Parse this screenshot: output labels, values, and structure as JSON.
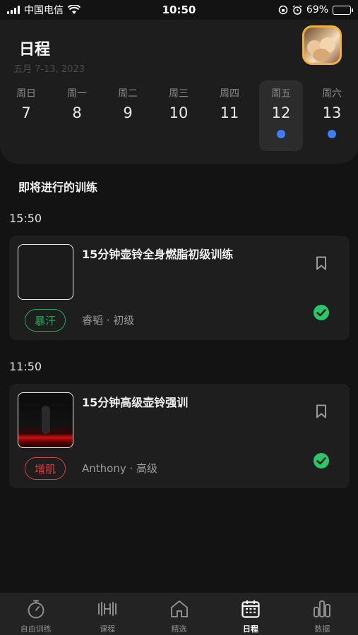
{
  "status_bar": {
    "carrier": "中国电信",
    "time": "10:50",
    "battery": "69%",
    "battery_level": 0.69
  },
  "header": {
    "title": "日程",
    "date_range": "五月 7-13, 2023",
    "avatar_icon": "dogs-photo-avatar"
  },
  "week": {
    "days": [
      {
        "name": "周日",
        "num": "7",
        "has_event": false
      },
      {
        "name": "周一",
        "num": "8",
        "has_event": false
      },
      {
        "name": "周二",
        "num": "9",
        "has_event": false
      },
      {
        "name": "周三",
        "num": "10",
        "has_event": false
      },
      {
        "name": "周四",
        "num": "11",
        "has_event": false
      },
      {
        "name": "周五",
        "num": "12",
        "has_event": true,
        "selected": true
      },
      {
        "name": "周六",
        "num": "13",
        "has_event": true
      }
    ]
  },
  "upcoming": {
    "title": "即将进行的训练",
    "items": [
      {
        "time": "15:50",
        "title": "15分钟壶铃全身燃脂初级训练",
        "tag": "暴汗",
        "tag_color": "#29a85a",
        "meta": "睿韬 · 初级",
        "completed": true
      },
      {
        "time": "11:50",
        "title": "15分钟高级壶铃强训",
        "tag": "增肌",
        "tag_color": "#d8403c",
        "meta": "Anthony · 高级",
        "completed": true
      }
    ]
  },
  "tabbar": {
    "items": [
      {
        "label": "自由训练",
        "icon": "stopwatch-icon"
      },
      {
        "label": "课程",
        "icon": "dumbbell-icon"
      },
      {
        "label": "精选",
        "icon": "home-icon"
      },
      {
        "label": "日程",
        "icon": "calendar-icon",
        "active": true
      },
      {
        "label": "数据",
        "icon": "bar-chart-icon"
      }
    ]
  },
  "colors": {
    "accent_blue": "#3f7df4",
    "check_green": "#29c76a"
  }
}
